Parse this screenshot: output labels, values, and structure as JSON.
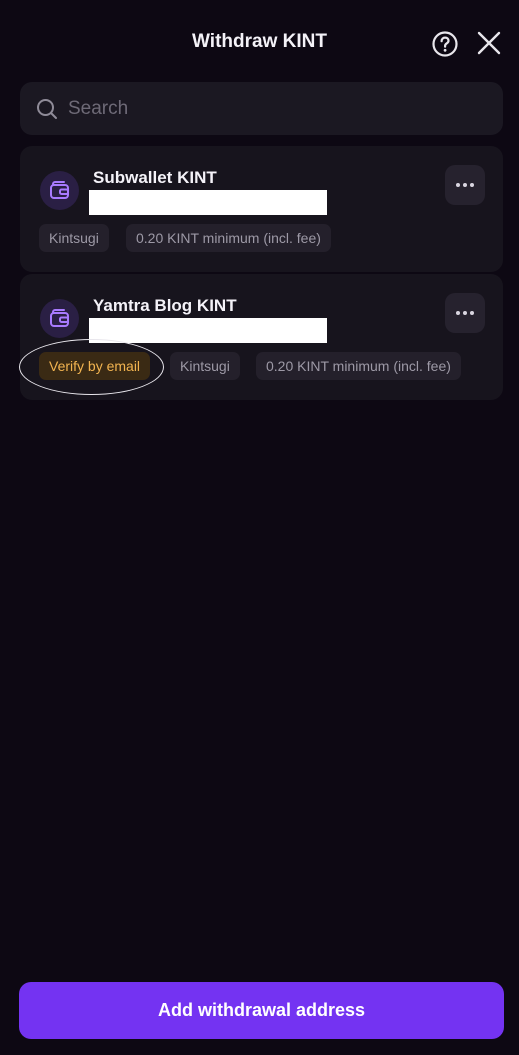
{
  "header": {
    "title": "Withdraw KINT",
    "help_icon": "question-circle-icon",
    "close_icon": "close-icon"
  },
  "search": {
    "placeholder": "Search",
    "value": "",
    "icon": "search-icon"
  },
  "addresses": [
    {
      "name": "Subwallet KINT",
      "address_redacted": true,
      "icon": "wallet-icon",
      "tags": [
        "Kintsugi",
        "0.20 KINT minimum (incl. fee)"
      ]
    },
    {
      "name": "Yamtra Blog KINT",
      "address_redacted": true,
      "icon": "wallet-icon",
      "warning_tag": "Verify by email",
      "tags": [
        "Kintsugi",
        "0.20 KINT minimum (incl. fee)"
      ]
    }
  ],
  "footer": {
    "add_button_label": "Add withdrawal address"
  },
  "colors": {
    "background": "#0d0813",
    "card": "#17141d",
    "accent": "#7433f2",
    "warning_text": "#f2b450",
    "icon_accent": "#a97bff"
  }
}
